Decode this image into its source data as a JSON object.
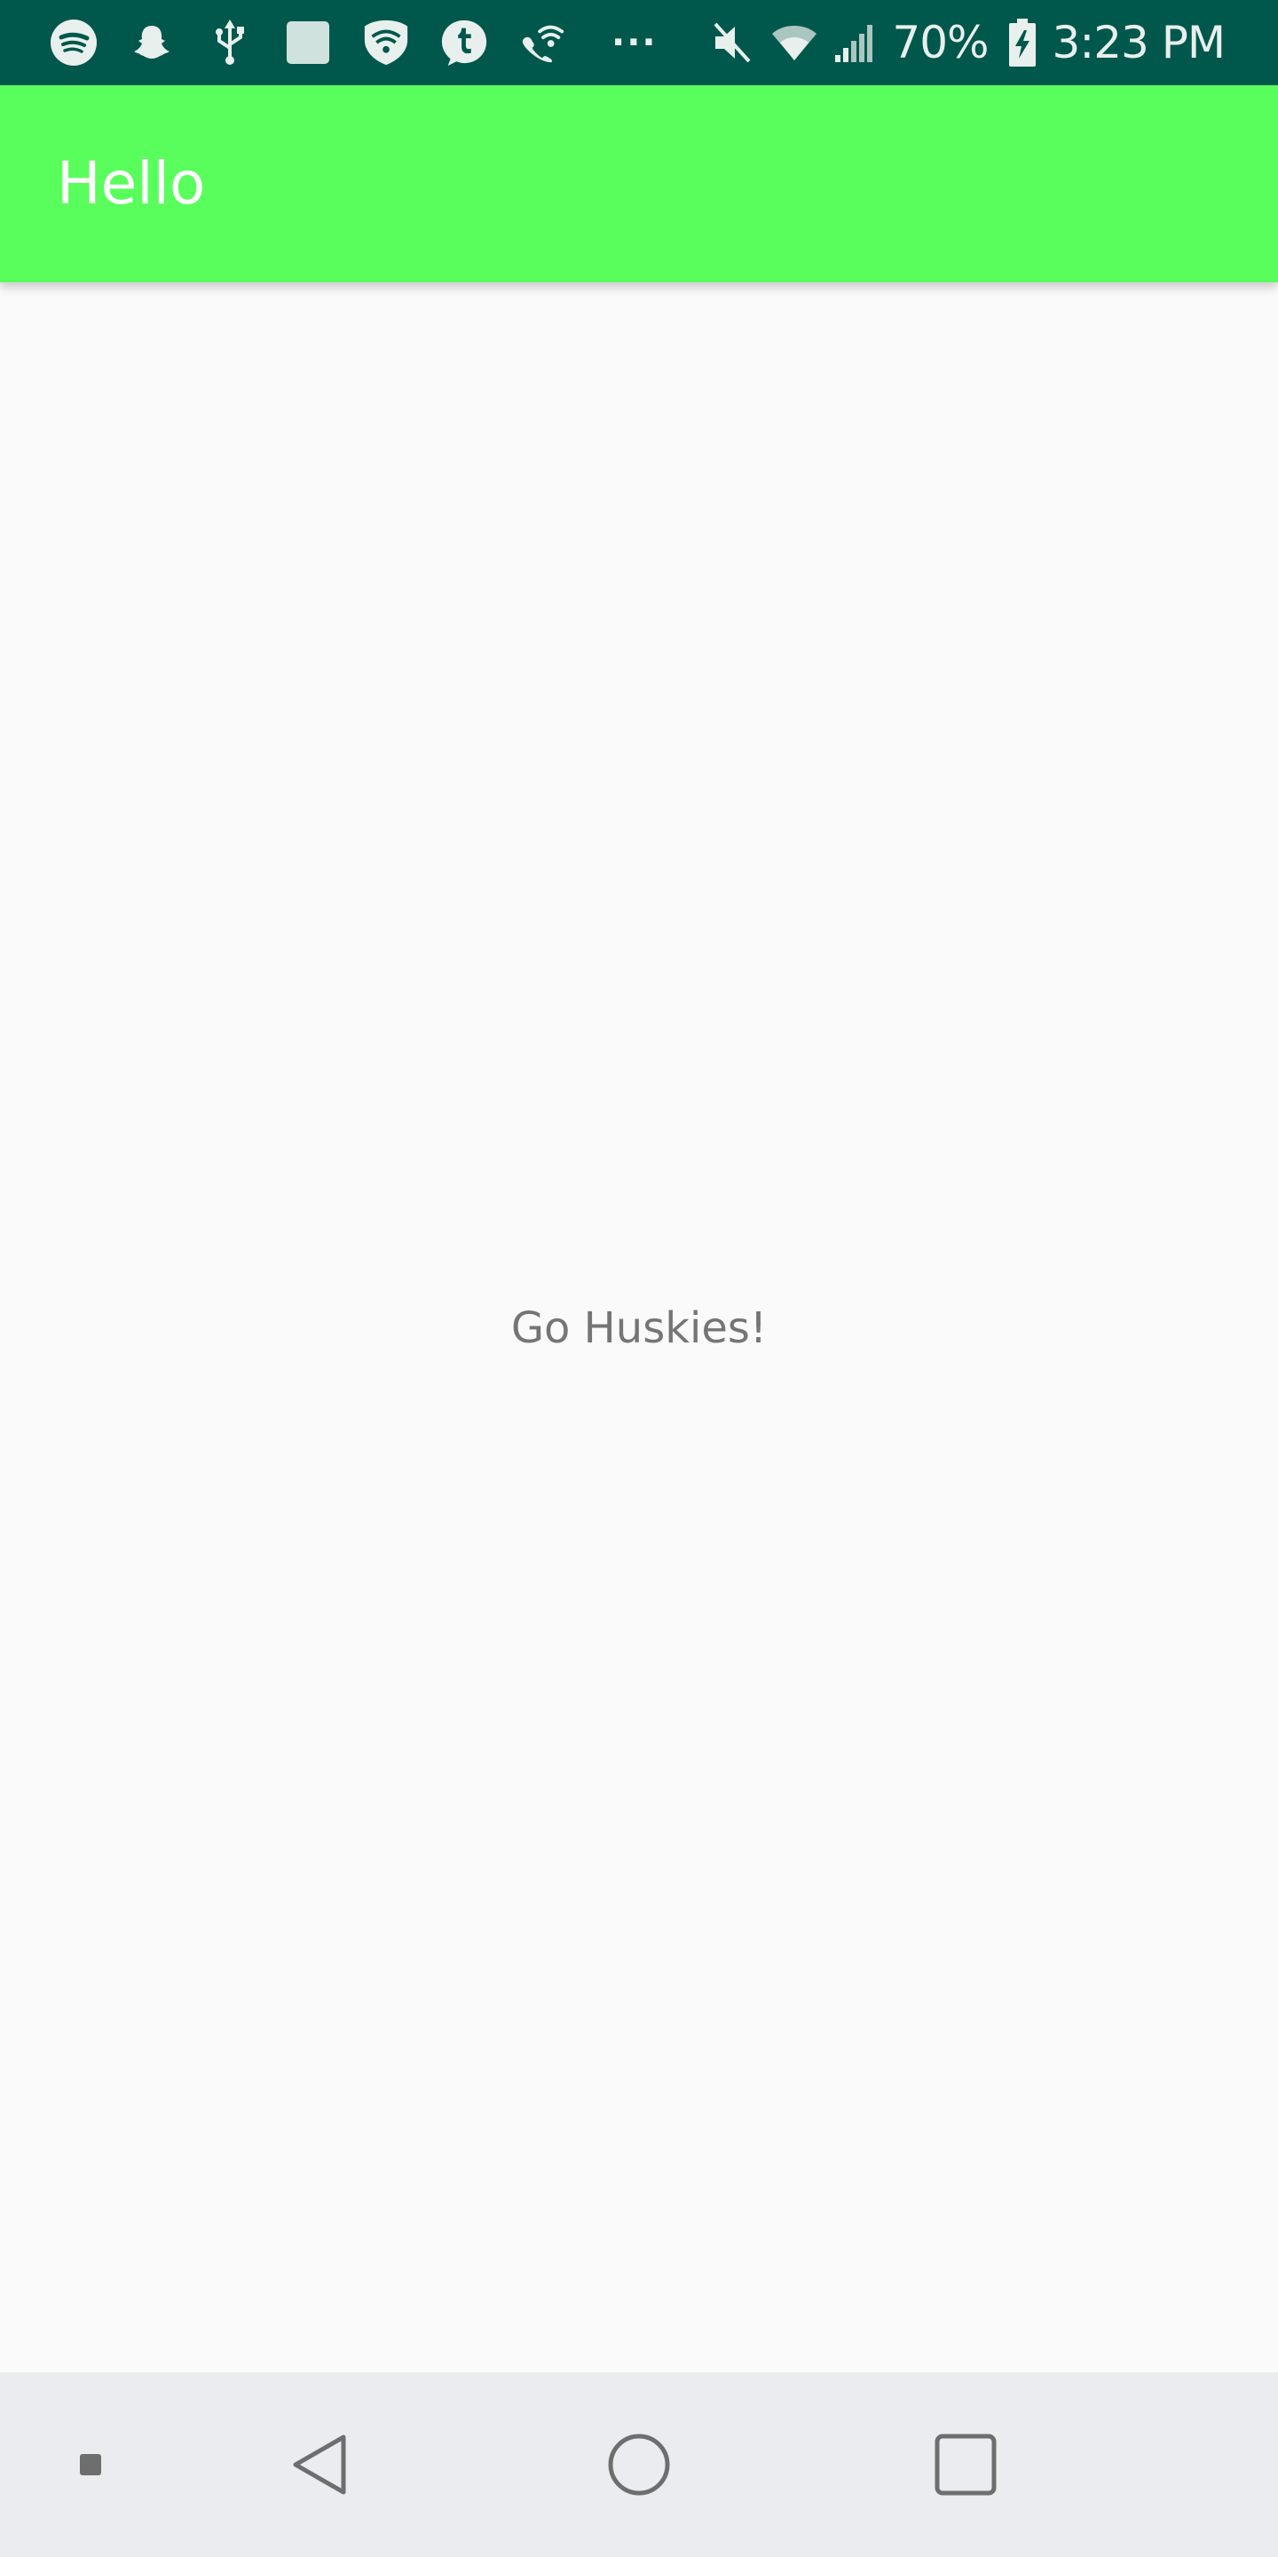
{
  "status_bar": {
    "battery_percent": "70%",
    "time": "3:23 PM",
    "overflow_dots": "···",
    "left_icons": [
      "spotify-icon",
      "snapchat-icon",
      "usb-icon",
      "square-notification-icon",
      "vpn-shield-icon",
      "tumblr-icon",
      "wifi-calling-icon"
    ],
    "right_icons": [
      "mute-icon",
      "wifi-icon",
      "signal-icon",
      "battery-charging-icon"
    ],
    "background_color": "#00574b"
  },
  "app_bar": {
    "title": "Hello",
    "background_color": "#5afe5c"
  },
  "main": {
    "message": "Go Huskies!"
  },
  "nav_bar": {
    "buttons": [
      "small-square-icon",
      "back-icon",
      "home-icon",
      "recents-icon"
    ],
    "background_color": "#ebecef"
  }
}
